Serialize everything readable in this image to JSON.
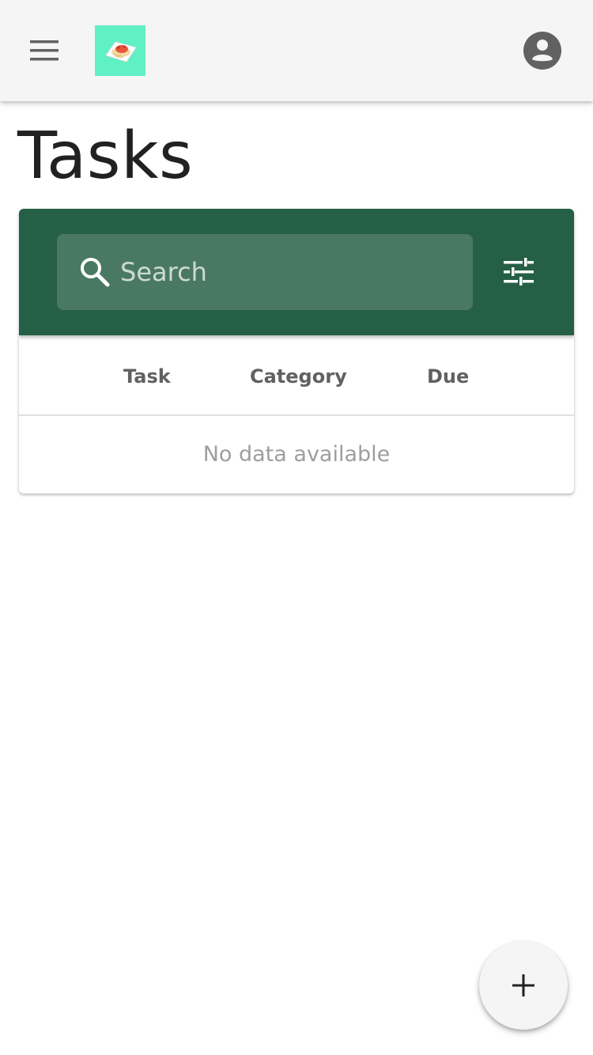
{
  "appbar": {
    "menu_icon": "hamburger-menu-icon",
    "logo_icon": "food-plate-icon",
    "logo_color": "#5ff0c4",
    "account_icon": "account-circle-icon",
    "background": "#f5f5f5"
  },
  "page": {
    "title": "Tasks"
  },
  "toolbar": {
    "background": "#255f45",
    "search_icon": "search-icon",
    "filter_icon": "tune-sliders-icon"
  },
  "search": {
    "placeholder": "Search",
    "value": ""
  },
  "table": {
    "columns": [
      "Task",
      "Category",
      "Due"
    ],
    "rows": [],
    "empty_text": "No data available"
  },
  "fab": {
    "icon": "plus-icon"
  }
}
